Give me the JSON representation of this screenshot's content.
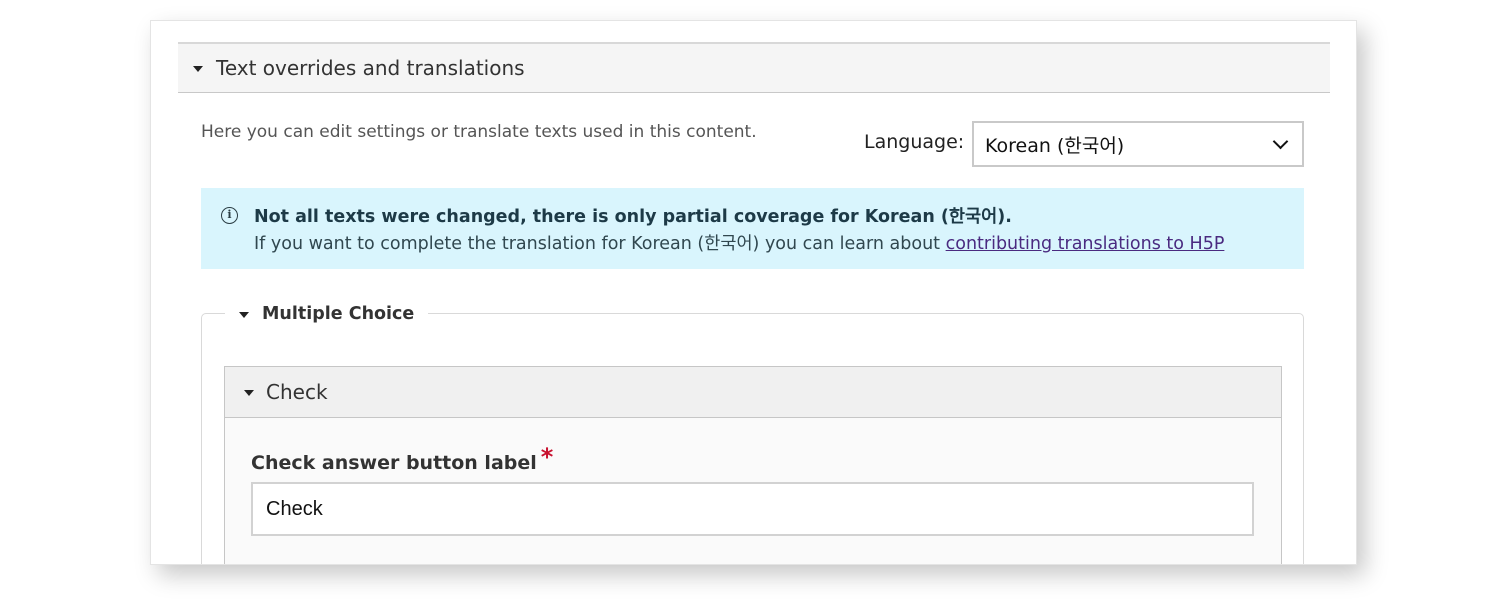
{
  "section": {
    "title": "Text overrides and translations",
    "description": "Here you can edit settings or translate texts used in this content."
  },
  "language": {
    "label": "Language:",
    "selected": "Korean (한국어)"
  },
  "notice": {
    "icon": "info-icon",
    "title": "Not all texts were changed, there is only partial coverage for Korean (한국어).",
    "body": "If you want to complete the translation for Korean (한국어) you can learn about ",
    "link_text": "contributing translations to H5P"
  },
  "fieldset": {
    "legend": "Multiple Choice"
  },
  "group": {
    "title": "Check",
    "field": {
      "label": "Check answer button label",
      "required_marker": "*",
      "value": "Check"
    }
  },
  "colors": {
    "notice_background": "#d9f5fd",
    "link": "#4a2a80",
    "required": "#c8102e"
  }
}
